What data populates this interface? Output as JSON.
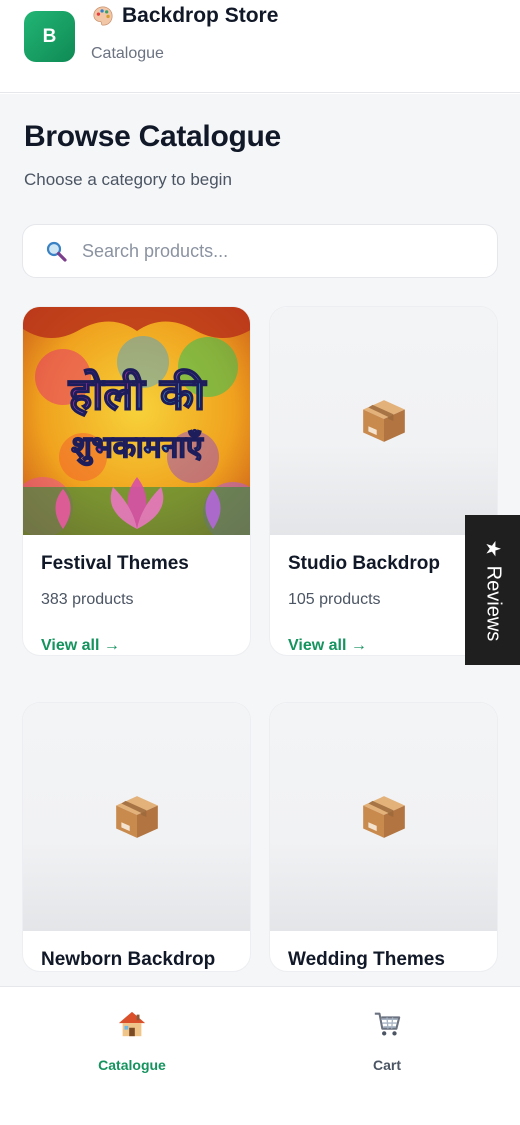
{
  "header": {
    "logo_letter": "B",
    "brand": "Backdrop Store",
    "breadcrumb": "Catalogue"
  },
  "page": {
    "title": "Browse Catalogue",
    "subtitle": "Choose a category to begin"
  },
  "search": {
    "placeholder": "Search products...",
    "value": ""
  },
  "categories": [
    {
      "name": "Festival Themes",
      "count": "383 products",
      "link": "View all →",
      "image": "holi-festival-banner",
      "image_text": "होली की शुभकामनाएँ"
    },
    {
      "name": "Studio Backdrop",
      "count": "105 products",
      "link": "View all →",
      "image": "package-icon"
    },
    {
      "name": "Newborn Backdrop",
      "image": "package-icon"
    },
    {
      "name": "Wedding Themes",
      "image": "package-icon"
    }
  ],
  "reviews_tab": {
    "label": "Reviews",
    "icon": "star-icon"
  },
  "bottom_nav": [
    {
      "label": "Catalogue",
      "icon": "house-icon",
      "active": true
    },
    {
      "label": "Cart",
      "icon": "shopping-cart-icon",
      "active": false
    }
  ],
  "colors": {
    "accent": "#15935e",
    "brand_gradient_start": "#22b574",
    "brand_gradient_end": "#0f8a55",
    "page_bg": "#f5f6f8",
    "reviews_tab_bg": "#1f1f1f"
  }
}
